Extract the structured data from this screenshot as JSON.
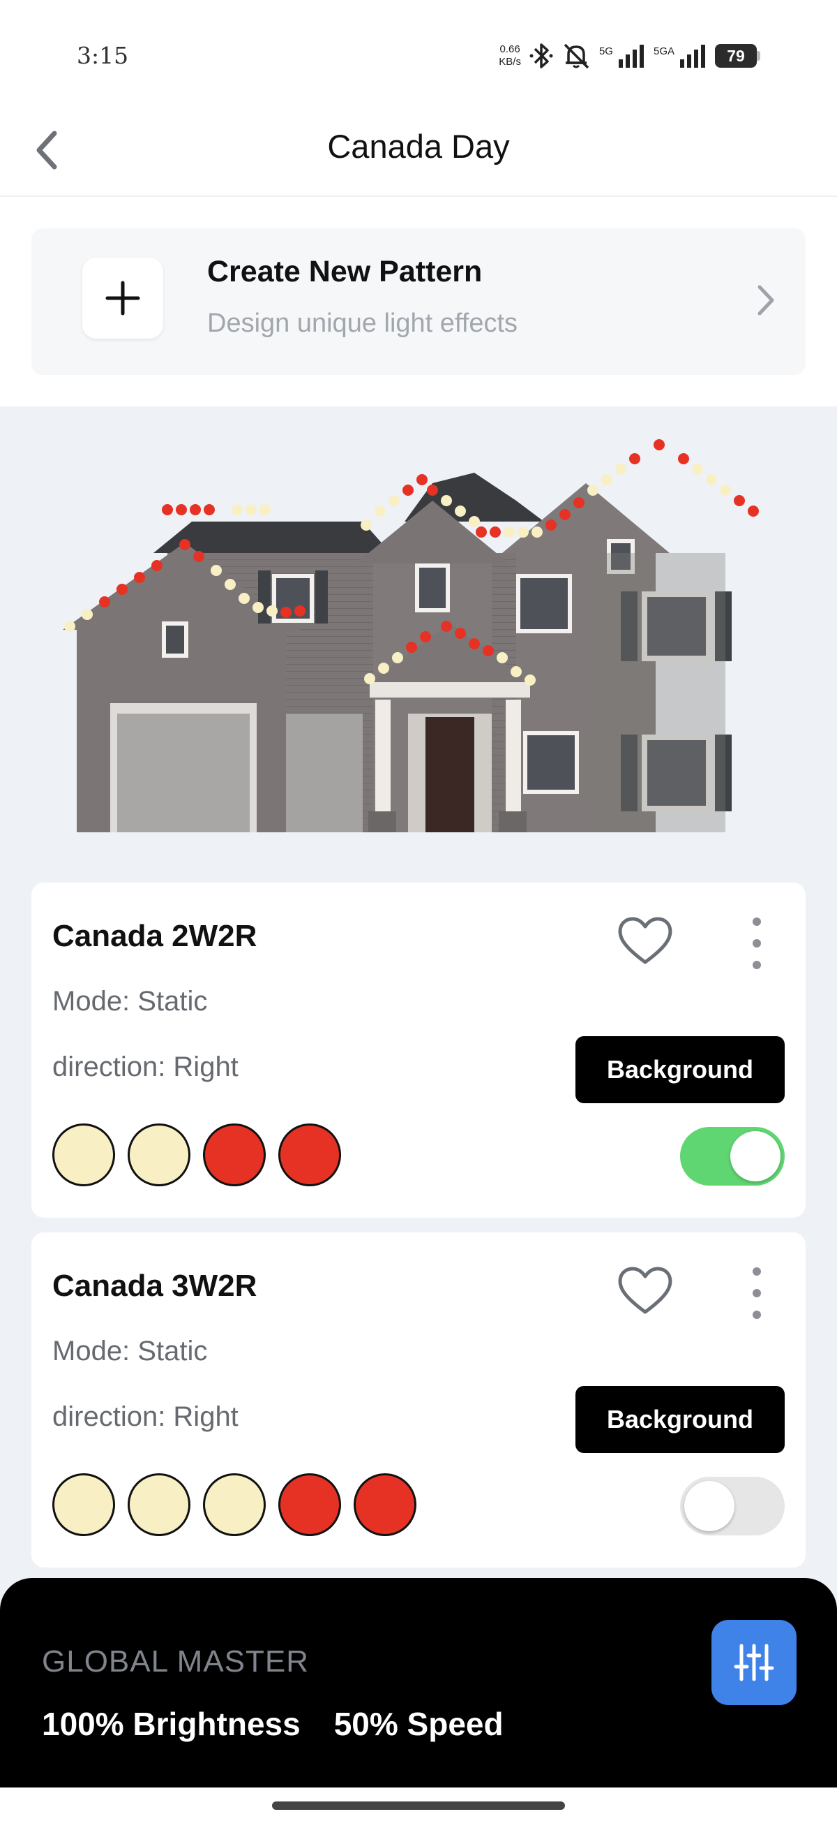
{
  "status_bar": {
    "time": "3:15",
    "net_speed_value": "0.66",
    "net_speed_unit": "KB/s",
    "signal1_label": "5G",
    "signal2_label": "5GA",
    "battery": "79"
  },
  "header": {
    "title": "Canada Day",
    "back_icon": "chevron-left-icon"
  },
  "create_pattern": {
    "title": "Create New Pattern",
    "subtitle": "Design unique light effects",
    "icon": "plus-icon"
  },
  "patterns": [
    {
      "name": "Canada 2W2R",
      "mode": "Mode: Static",
      "direction": "direction: Right",
      "button": "Background",
      "colors": [
        "#f8f0c4",
        "#f8f0c4",
        "#e63224",
        "#e63224"
      ],
      "enabled": true
    },
    {
      "name": "Canada 3W2R",
      "mode": "Mode: Static",
      "direction": "direction: Right",
      "button": "Background",
      "colors": [
        "#f8f0c4",
        "#f8f0c4",
        "#f8f0c4",
        "#e63224",
        "#e63224"
      ],
      "enabled": false
    }
  ],
  "global_master": {
    "label": "GLOBAL MASTER",
    "brightness": "100% Brightness",
    "speed": "50% Speed",
    "icon": "sliders-icon"
  },
  "colors": {
    "toggle_on": "#5fd672",
    "accent_blue": "#3f82e8",
    "light_warm_white": "#f8f0c4",
    "light_red": "#e63224"
  }
}
